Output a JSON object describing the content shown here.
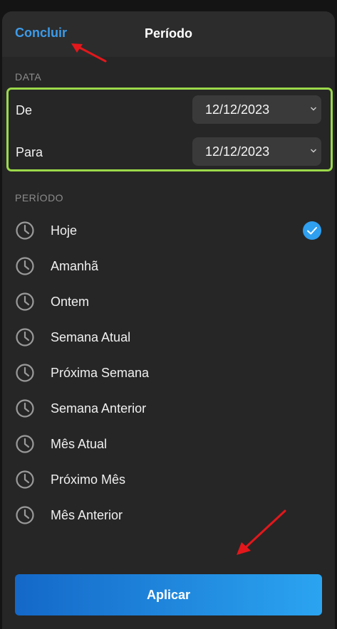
{
  "header": {
    "done_label": "Concluir",
    "title": "Período"
  },
  "date_section": {
    "label": "DATA",
    "from_label": "De",
    "from_value": "12/12/2023",
    "to_label": "Para",
    "to_value": "12/12/2023"
  },
  "period_section": {
    "label": "PERÍODO",
    "items": [
      {
        "label": "Hoje",
        "selected": true
      },
      {
        "label": "Amanhã",
        "selected": false
      },
      {
        "label": "Ontem",
        "selected": false
      },
      {
        "label": "Semana Atual",
        "selected": false
      },
      {
        "label": "Próxima Semana",
        "selected": false
      },
      {
        "label": "Semana Anterior",
        "selected": false
      },
      {
        "label": "Mês Atual",
        "selected": false
      },
      {
        "label": "Próximo Mês",
        "selected": false
      },
      {
        "label": "Mês Anterior",
        "selected": false
      }
    ]
  },
  "apply_label": "Aplicar",
  "colors": {
    "accent": "#3d9bea",
    "highlight_border": "#9bd94a",
    "annotation_arrow": "#e3171b",
    "check_fill": "#2f9ff0"
  },
  "icons": {
    "period_item": "clock-icon",
    "selected": "check-circle-icon",
    "picker": "chevron-down-icon"
  }
}
